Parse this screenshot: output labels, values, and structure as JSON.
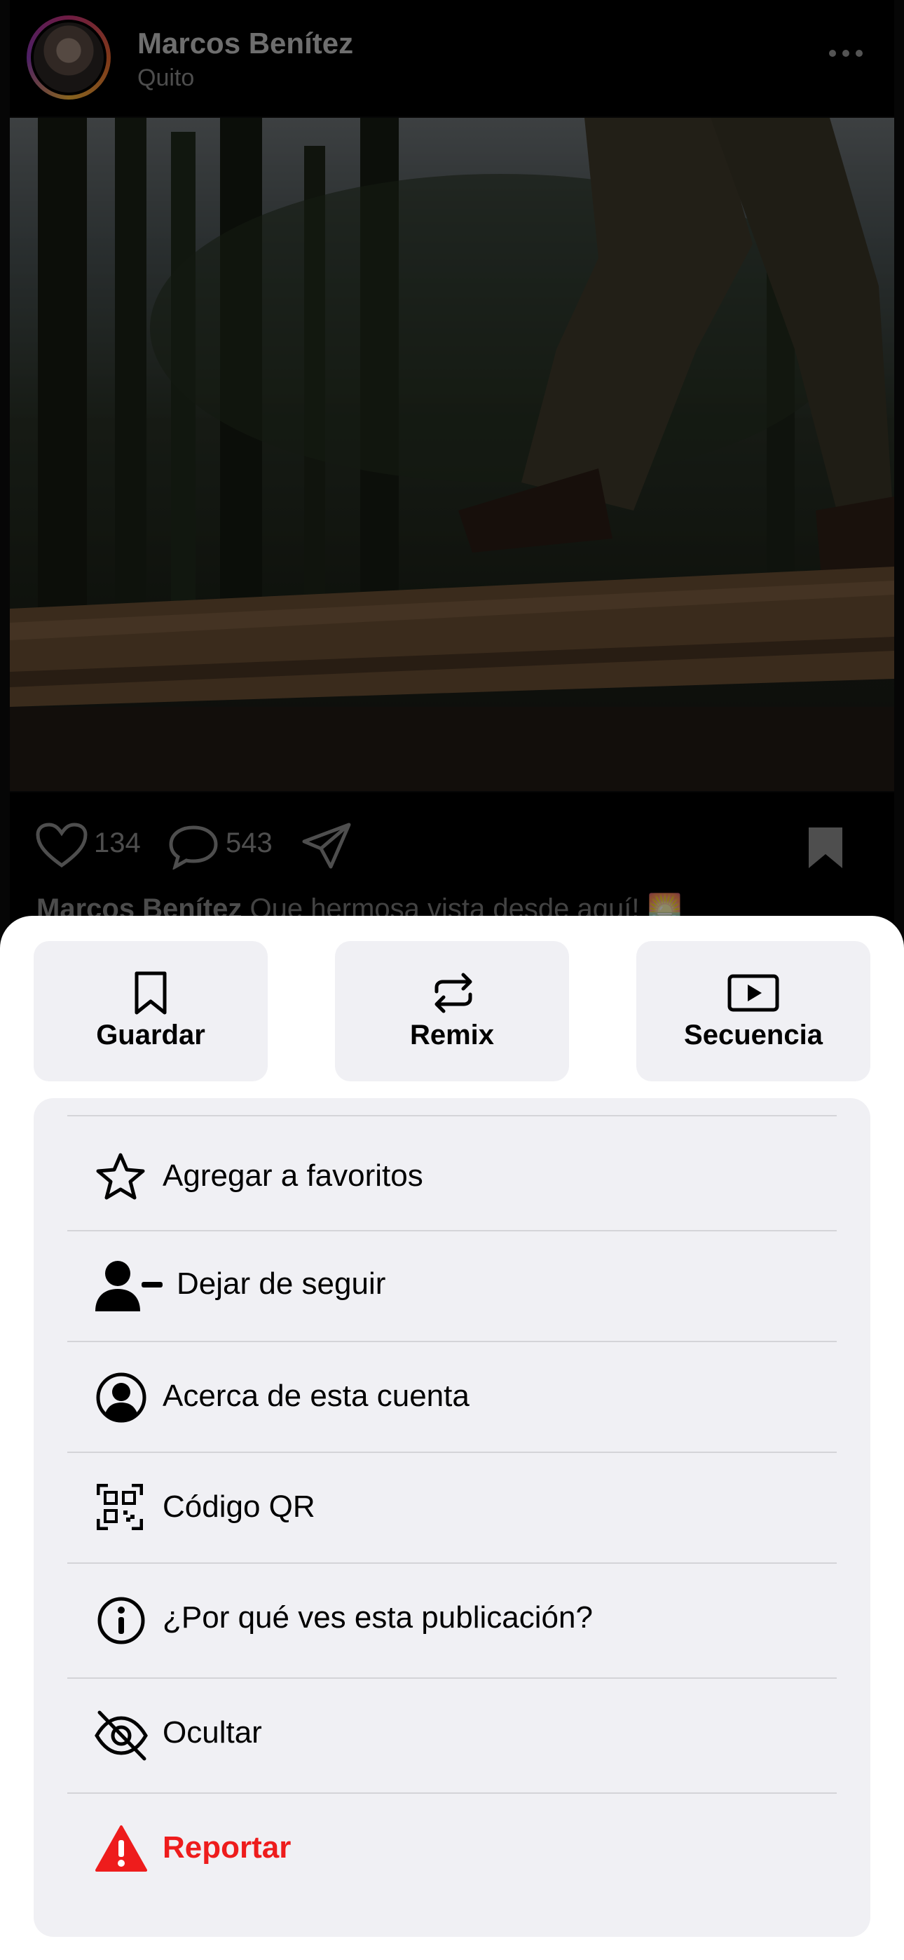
{
  "post": {
    "username": "Marcos Benítez",
    "location": "Quito",
    "likes": "134",
    "comments": "543",
    "caption_user": "Marcos Benítez",
    "caption_text": "Que hermosa vista desde aquí! 🌅"
  },
  "sheet": {
    "top_actions": [
      {
        "label": "Guardar",
        "icon": "bookmark-icon"
      },
      {
        "label": "Remix",
        "icon": "remix-icon"
      },
      {
        "label": "Secuencia",
        "icon": "play-icon"
      }
    ],
    "items": [
      {
        "label": "Agregar a favoritos",
        "icon": "star-icon"
      },
      {
        "label": "Dejar de seguir",
        "icon": "person-minus-icon"
      },
      {
        "label": "Acerca de esta cuenta",
        "icon": "person-circle-icon"
      },
      {
        "label": "Código QR",
        "icon": "qr-code-icon"
      },
      {
        "label": "¿Por qué ves esta publicación?",
        "icon": "info-icon"
      },
      {
        "label": "Ocultar",
        "icon": "eye-slash-icon"
      },
      {
        "label": "Reportar",
        "icon": "warning-icon",
        "color": "#ee1c1c"
      }
    ]
  },
  "colors": {
    "sheet_bg": "#ffffff",
    "group_bg": "#f0f0f4",
    "danger": "#ee1c1c"
  }
}
